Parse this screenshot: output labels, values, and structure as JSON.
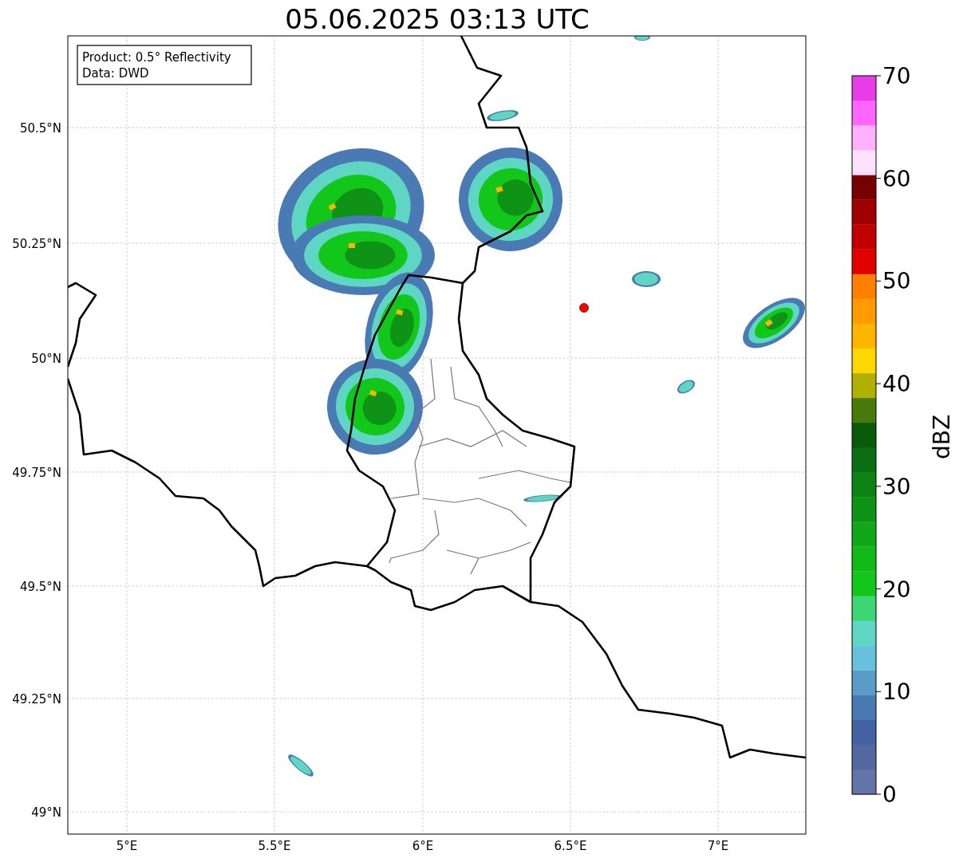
{
  "title": "05.06.2025 03:13 UTC",
  "info_box": {
    "lines": [
      "Product: 0.5° Reflectivity",
      "Data: DWD"
    ]
  },
  "map": {
    "lat_ticks": [
      "50.5°N",
      "50.25°N",
      "50°N",
      "49.75°N",
      "49.5°N",
      "49.25°N",
      "49°N"
    ],
    "lon_ticks": [
      "5°E",
      "5.5°E",
      "6°E",
      "6.5°E",
      "7°E"
    ]
  },
  "colorbar": {
    "label": "dBZ",
    "ticks": [
      "70",
      "60",
      "50",
      "40",
      "30",
      "20",
      "10",
      "0"
    ],
    "segments": [
      {
        "color": "#6374a8"
      },
      {
        "color": "#5368a0"
      },
      {
        "color": "#4361a3"
      },
      {
        "color": "#4a7ab4"
      },
      {
        "color": "#5a9bc8"
      },
      {
        "color": "#66c2dc"
      },
      {
        "color": "#5fd6c4"
      },
      {
        "color": "#3dd674"
      },
      {
        "color": "#12c71a"
      },
      {
        "color": "#10bb18"
      },
      {
        "color": "#10a818"
      },
      {
        "color": "#0e9316"
      },
      {
        "color": "#0d8214"
      },
      {
        "color": "#0b6e12"
      },
      {
        "color": "#0a5a0c"
      },
      {
        "color": "#467a0a"
      },
      {
        "color": "#b0b000"
      },
      {
        "color": "#ffd700"
      },
      {
        "color": "#ffb400"
      },
      {
        "color": "#ff9a00"
      },
      {
        "color": "#ff8000"
      },
      {
        "color": "#e00000"
      },
      {
        "color": "#c00000"
      },
      {
        "color": "#a00000"
      },
      {
        "color": "#780000"
      },
      {
        "color": "#ffe0ff"
      },
      {
        "color": "#ffb0ff"
      },
      {
        "color": "#ff66ff"
      },
      {
        "color": "#e83ce8"
      }
    ]
  }
}
